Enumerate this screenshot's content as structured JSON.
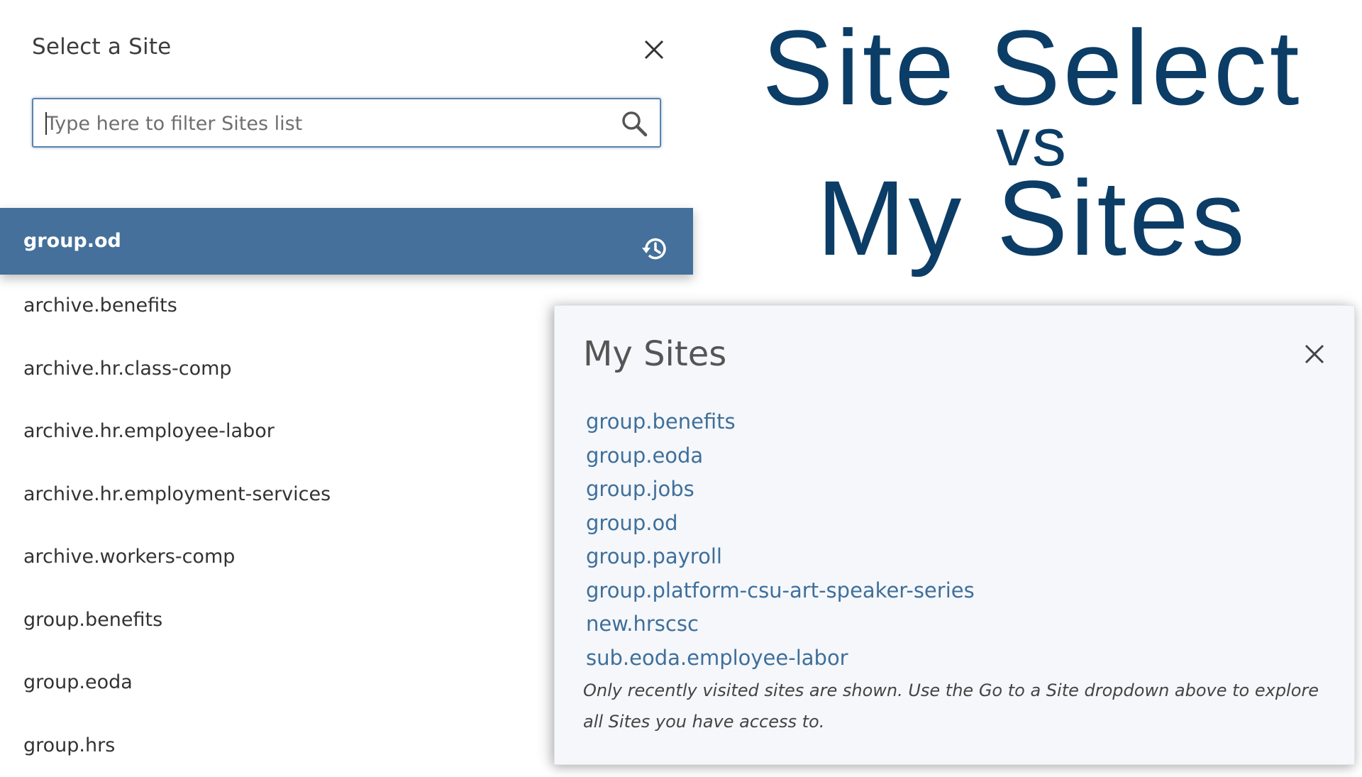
{
  "headline": {
    "line1": "Site Select",
    "line2": "vs",
    "line3": "My Sites"
  },
  "site_select": {
    "title": "Select a Site",
    "close_icon": "close-icon",
    "search": {
      "value": "",
      "placeholder": "Type here to filter Sites list",
      "icon": "search-icon"
    },
    "selected_item": {
      "label": "group.od",
      "icon": "history-icon"
    },
    "items": [
      "archive.benefits",
      "archive.hr.class-comp",
      "archive.hr.employee-labor",
      "archive.hr.employment-services",
      "archive.workers-comp",
      "group.benefits",
      "group.eoda",
      "group.hrs"
    ]
  },
  "my_sites": {
    "title": "My Sites",
    "close_icon": "close-icon",
    "links": [
      "group.benefits",
      "group.eoda",
      "group.jobs",
      "group.od",
      "group.payroll",
      "group.platform-csu-art-speaker-series",
      "new.hrscsc",
      "sub.eoda.employee-labor"
    ],
    "note": "Only recently visited sites are shown. Use the Go to a Site dropdown above to explore all Sites you have access to."
  },
  "colors": {
    "headline": "#0b3d66",
    "selected_row": "#44709b",
    "link": "#3f6f9b",
    "search_border": "#5b82b0"
  }
}
